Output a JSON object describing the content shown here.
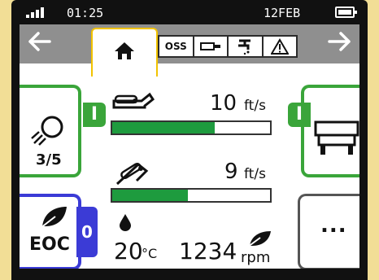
{
  "status_bar": {
    "time": "01:25",
    "date": "12FEB",
    "signal_bars": 4
  },
  "nav": {
    "back_icon": "arrow-left-icon",
    "forward_icon": "arrow-right-icon",
    "home_icon": "home-icon",
    "tabs": [
      {
        "label": "OSS",
        "icon": "oss-label"
      },
      {
        "label": "",
        "icon": "pto-shaft-icon"
      },
      {
        "label": "",
        "icon": "hydraulic-valve-icon"
      },
      {
        "label": "",
        "icon": "warning-icon"
      }
    ]
  },
  "tiles": {
    "work_lights": {
      "icon": "work-light-icon",
      "value": "3/5",
      "badge": "I"
    },
    "implement": {
      "icon": "implement-icon",
      "badge": "I"
    },
    "eco": {
      "icon": "leaf-icon",
      "label": "EOC",
      "badge": "0"
    },
    "more": {
      "label": "..."
    }
  },
  "gauges": [
    {
      "icon": "wheel-speed-icon",
      "value": "10",
      "unit": "ft/s",
      "fill": 0.65
    },
    {
      "icon": "ground-speed-icon",
      "value": "9",
      "unit": "ft/s",
      "fill": 0.48
    }
  ],
  "readouts": {
    "temperature": {
      "icon": "oil-drop-icon",
      "value": "20",
      "unit": "°C"
    },
    "engine": {
      "icon": "leaf-icon",
      "value": "1234",
      "unit": "rpm"
    }
  },
  "colors": {
    "accent_green": "#1e9b3e",
    "tile_green": "#3aa53a",
    "tile_blue": "#3b3bd6",
    "tab_highlight": "#f2c300"
  }
}
